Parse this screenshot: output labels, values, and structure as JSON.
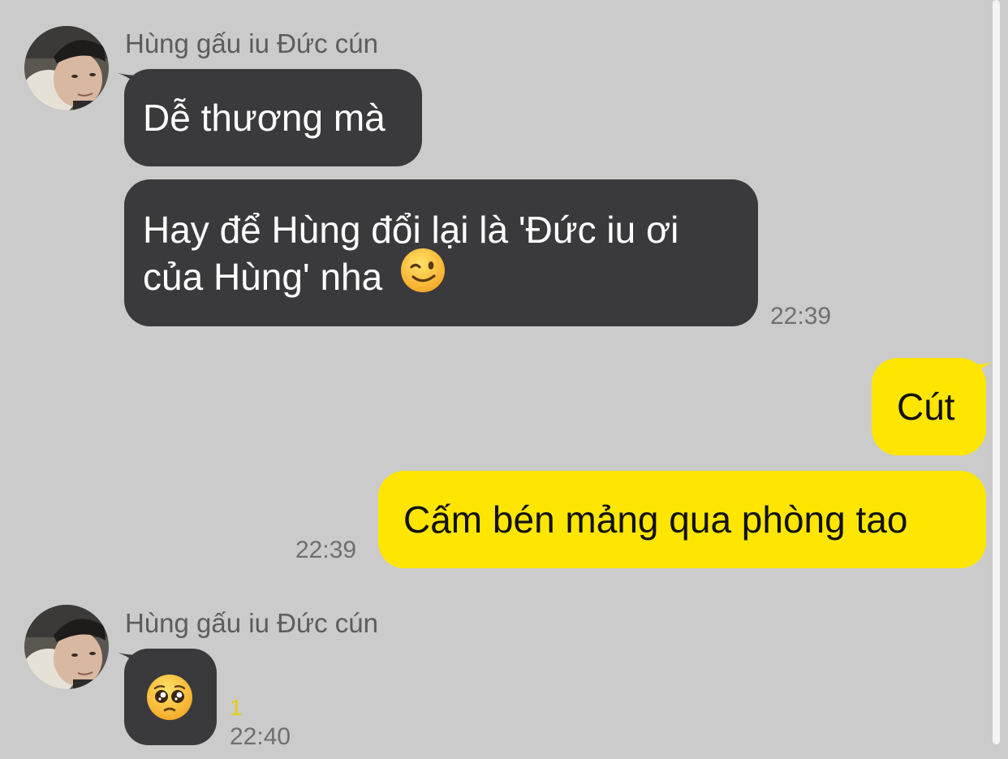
{
  "colors": {
    "background": "#cbcbcb",
    "incoming_bubble": "#3a3a3c",
    "outgoing_bubble": "#ffe600",
    "unread": "#e8cd00"
  },
  "conversation": {
    "groups": [
      {
        "sender": "Hùng gấu iu Đức cún",
        "avatar": "profile-photo",
        "messages": [
          {
            "direction": "in",
            "text": "Dễ thương mà"
          },
          {
            "direction": "in",
            "lines": [
              "Hay để Hùng đổi lại là 'Đức iu ơi",
              "của Hùng' nha"
            ],
            "emoji": "winking-face-emoji",
            "time": "22:39"
          }
        ]
      },
      {
        "sender": "",
        "messages": [
          {
            "direction": "out",
            "text": "Cút"
          },
          {
            "direction": "out",
            "text": "Cấm bén mảng qua phòng tao",
            "time": "22:39"
          }
        ]
      },
      {
        "sender": "Hùng gấu iu Đức cún",
        "avatar": "profile-photo",
        "messages": [
          {
            "direction": "in",
            "emoji": "pleading-face-emoji",
            "unread": "1",
            "time": "22:40"
          }
        ]
      }
    ]
  }
}
